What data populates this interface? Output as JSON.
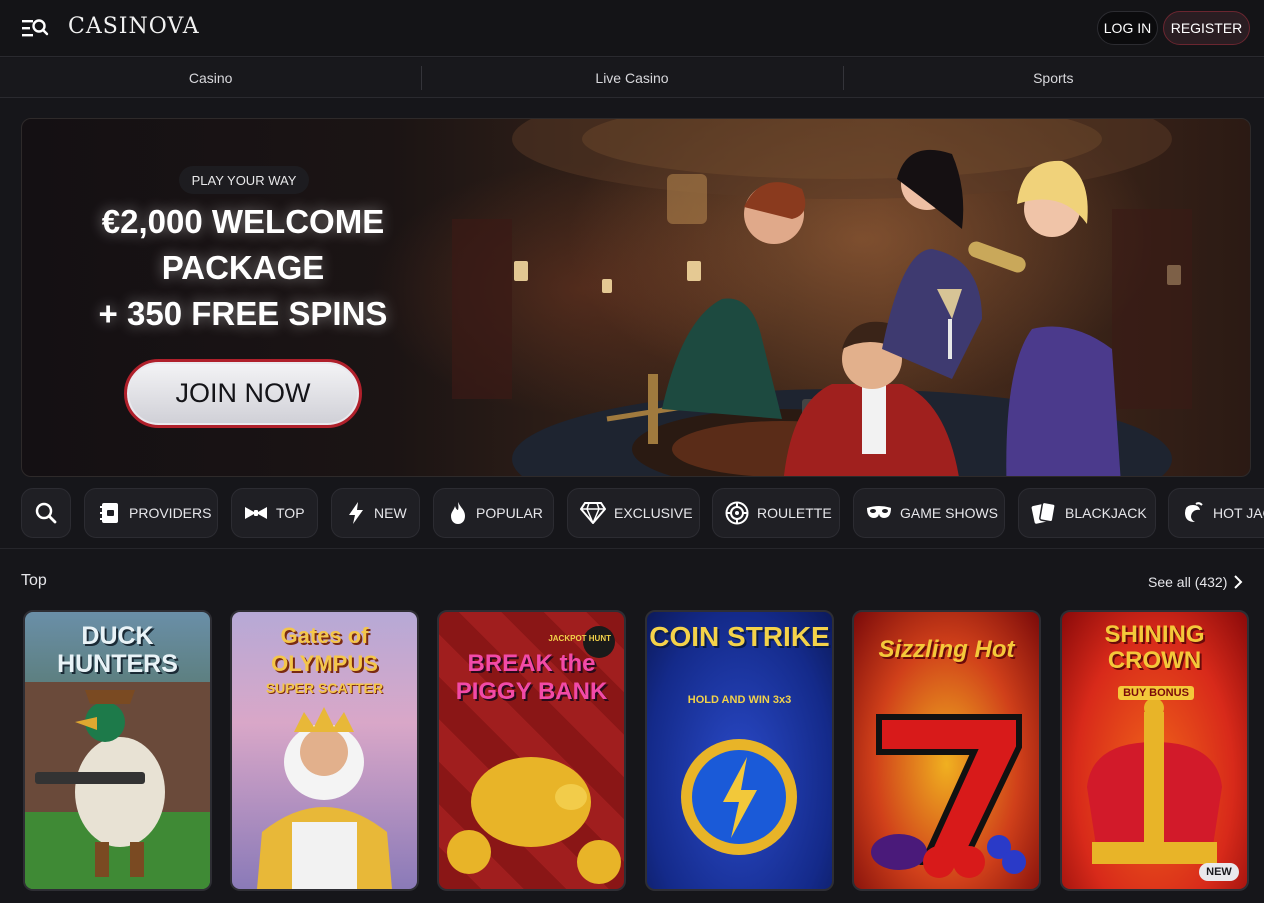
{
  "header": {
    "logo": "CASINOVA",
    "login_label": "LOG IN",
    "register_label": "REGISTER"
  },
  "nav": {
    "tabs": [
      "Casino",
      "Live Casino",
      "Sports"
    ]
  },
  "hero": {
    "badge": "PLAY YOUR WAY",
    "title_lines": [
      "€2,000 WELCOME",
      "PACKAGE",
      "+ 350 FREE SPINS"
    ],
    "cta": "JOIN NOW"
  },
  "filters": [
    {
      "label": "",
      "icon": "search-icon"
    },
    {
      "label": "PROVIDERS",
      "icon": "providers-icon"
    },
    {
      "label": "TOP",
      "icon": "bow-tie-icon"
    },
    {
      "label": "NEW",
      "icon": "lightning-icon"
    },
    {
      "label": "POPULAR",
      "icon": "flame-icon"
    },
    {
      "label": "EXCLUSIVE",
      "icon": "diamond-icon"
    },
    {
      "label": "ROULETTE",
      "icon": "roulette-icon"
    },
    {
      "label": "GAME SHOWS",
      "icon": "mask-icon"
    },
    {
      "label": "BLACKJACK",
      "icon": "cards-icon"
    },
    {
      "label": "HOT JAC",
      "icon": "chili-icon"
    }
  ],
  "section": {
    "title": "Top",
    "see_all": "See all (432)"
  },
  "games": [
    {
      "title": "DUCK HUNTERS",
      "subtitle": ""
    },
    {
      "title": "Gates of OLYMPUS",
      "subtitle": "SUPER SCATTER"
    },
    {
      "title": "BREAK the PIGGY BANK",
      "subtitle": "JACKPOT HUNT"
    },
    {
      "title": "COIN STRIKE",
      "subtitle": "HOLD AND WIN 3x3"
    },
    {
      "title": "Sizzling Hot",
      "subtitle": ""
    },
    {
      "title": "SHINING CROWN",
      "subtitle": "BUY BONUS",
      "badge": "NEW"
    }
  ],
  "colors": {
    "background": "#16161a",
    "register_border": "#6a2630",
    "join_border": "#b0202b"
  }
}
